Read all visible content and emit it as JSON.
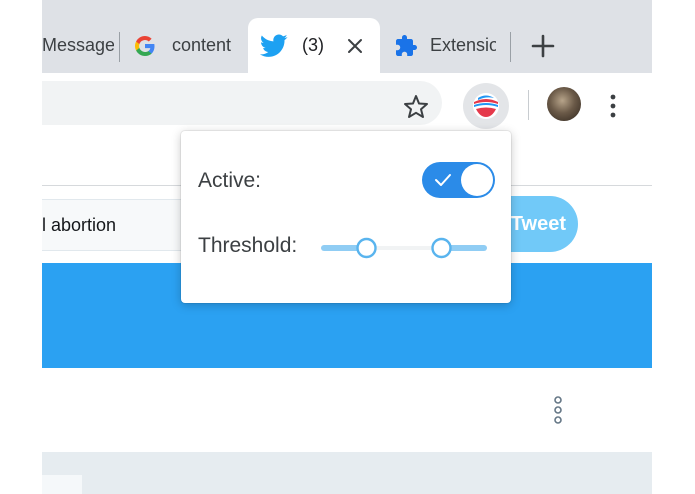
{
  "tabs": [
    {
      "label": "Messages",
      "icon": "none"
    },
    {
      "label": "content",
      "icon": "google-g-icon"
    },
    {
      "label": "(3)",
      "icon": "twitter-bird-icon",
      "active": true
    },
    {
      "label": "Extensions",
      "icon": "puzzle-icon"
    }
  ],
  "page": {
    "search_text": "l abortion",
    "tweet_button_label": "Tweet"
  },
  "popup": {
    "active_label": "Active:",
    "active_on": true,
    "threshold_label": "Threshold:",
    "threshold_range": [
      0.25,
      0.75
    ]
  },
  "colors": {
    "twitter_blue": "#2ba1f2",
    "toggle_blue": "#2b8be8",
    "slider_light": "#90cdf4"
  }
}
